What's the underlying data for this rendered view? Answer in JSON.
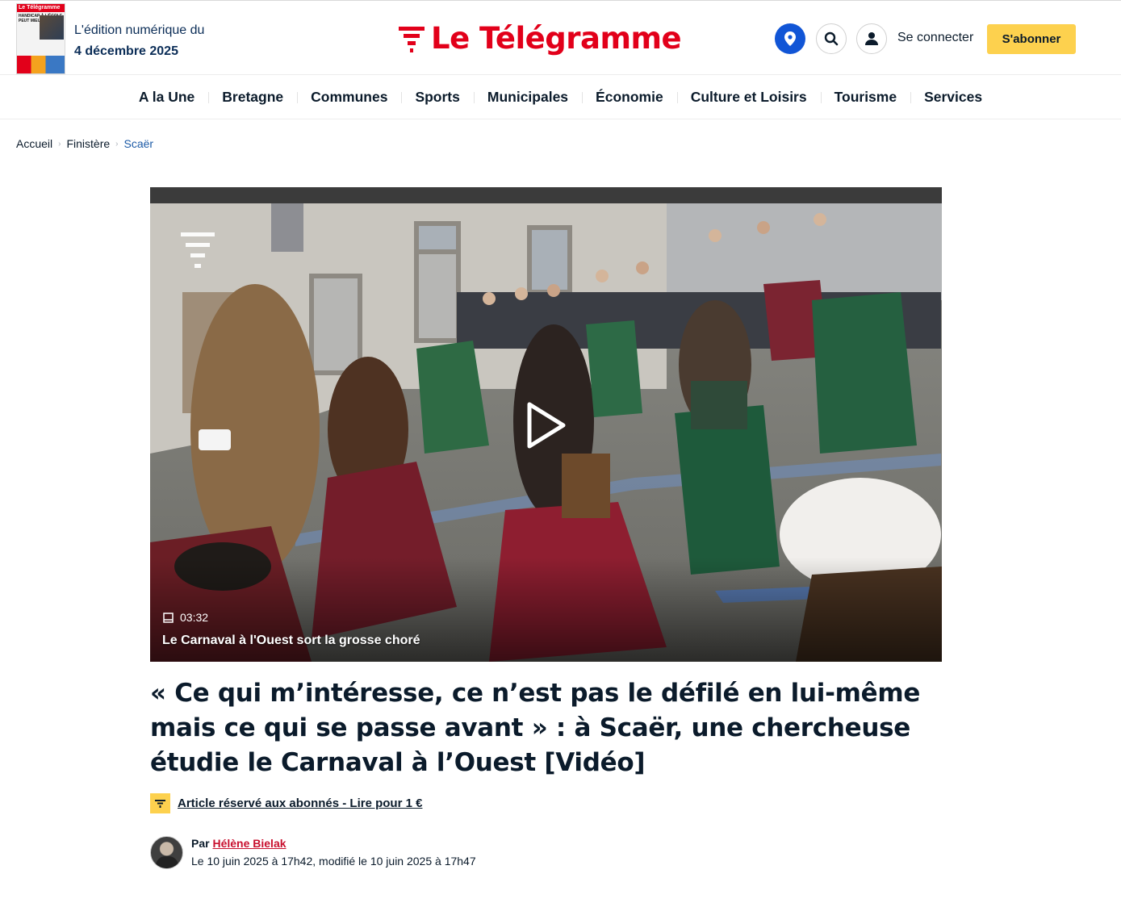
{
  "edition": {
    "label": "L'édition numérique du",
    "date": "4 décembre 2025",
    "thumb_mast": "Le Télégramme",
    "thumb_headline": "HANDICAP À L'ÉCOLE PEUT MIEUX FAIRE"
  },
  "brand": {
    "name": "Le Télégramme",
    "color": "#e2001a"
  },
  "header": {
    "location_icon": "location-pin-icon",
    "search_icon": "search-icon",
    "user_icon": "user-icon",
    "login_label": "Se connecter",
    "subscribe_label": "S'abonner",
    "accent": "#fdd14e",
    "location_color": "#1155d6"
  },
  "nav": {
    "items": [
      "A la Une",
      "Bretagne",
      "Communes",
      "Sports",
      "Municipales",
      "Économie",
      "Culture et Loisirs",
      "Tourisme",
      "Services"
    ]
  },
  "breadcrumb": {
    "items": [
      "Accueil",
      "Finistère",
      "Scaër"
    ]
  },
  "video": {
    "duration": "03:32",
    "title": "Le Carnaval à l'Ouest sort la grosse choré",
    "play_icon": "play-icon",
    "duration_icon": "video-icon"
  },
  "article": {
    "title": "« Ce qui m’intéresse, ce n’est pas le défilé en lui-même mais ce qui se passe avant » : à Scaër, une chercheuse étudie le Carnaval à l’Ouest [Vidéo]",
    "premium_label": "Article réservé aux abonnés - Lire pour 1 €",
    "author_prefix": "Par",
    "author_name": "Hélène Bielak",
    "dates": "Le 10 juin 2025 à 17h42, modifié le 10 juin 2025 à 17h47"
  }
}
